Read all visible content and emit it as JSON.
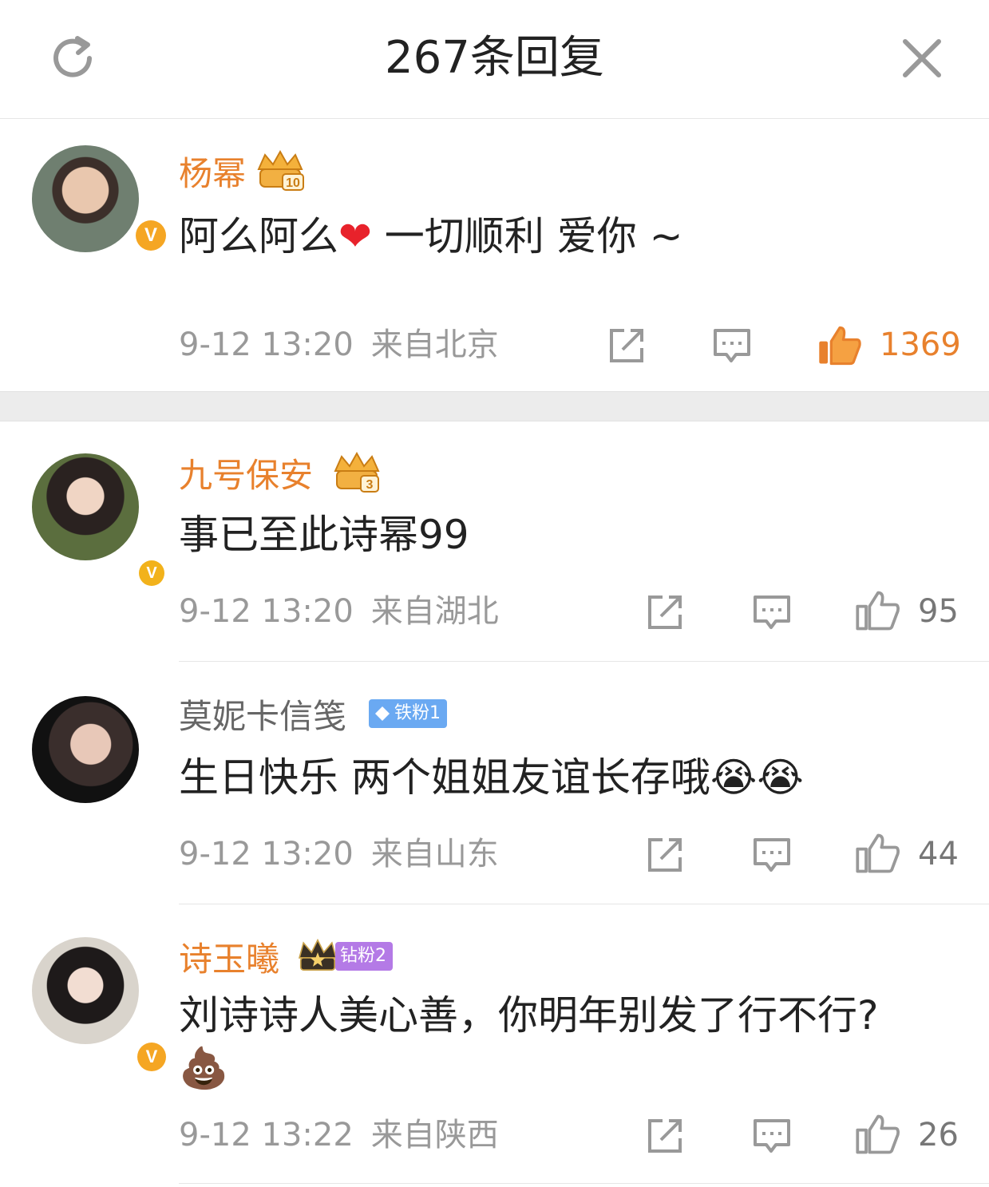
{
  "header": {
    "title": "267条回复",
    "refresh_icon": "refresh-icon",
    "close_icon": "close-icon"
  },
  "colors": {
    "accent": "#e8812d",
    "text": "#222222",
    "meta": "#999999",
    "verified_orange": "#f5a623",
    "verified_yellow": "#f2b21b",
    "iron_fan": "#6aa9f2",
    "diamond_fan": "#b47ae6"
  },
  "comments": [
    {
      "username": "杨幂",
      "badge": {
        "type": "crown",
        "level": "10"
      },
      "text_main": "阿么阿么",
      "text_emoji": "❤",
      "text_rest": " 一切顺利 爱你 ~",
      "date": "9-12 13:20",
      "location": "来自北京",
      "likes": "1369",
      "liked": true,
      "verified": "orange"
    },
    {
      "username": "九号保安",
      "badge": {
        "type": "crown",
        "level": "3"
      },
      "text_main": "事已至此诗幂99",
      "date": "9-12 13:20",
      "location": "来自湖北",
      "likes": "95",
      "liked": false,
      "verified": "yellow"
    },
    {
      "username": "莫妮卡信笺",
      "badge": {
        "type": "fan",
        "label": "铁粉1"
      },
      "text_main": "生日快乐 两个姐姐友谊长存哦",
      "text_emoji": "😭😭",
      "date": "9-12 13:20",
      "location": "来自山东",
      "likes": "44",
      "liked": false,
      "verified": "none"
    },
    {
      "username": "诗玉曦",
      "badge": {
        "type": "fan",
        "label": "钻粉2"
      },
      "text_main": "刘诗诗人美心善，你明年别发了行不行?",
      "text_line2": "💩",
      "date": "9-12 13:22",
      "location": "来自陕西",
      "likes": "26",
      "liked": false,
      "verified": "orange"
    }
  ]
}
